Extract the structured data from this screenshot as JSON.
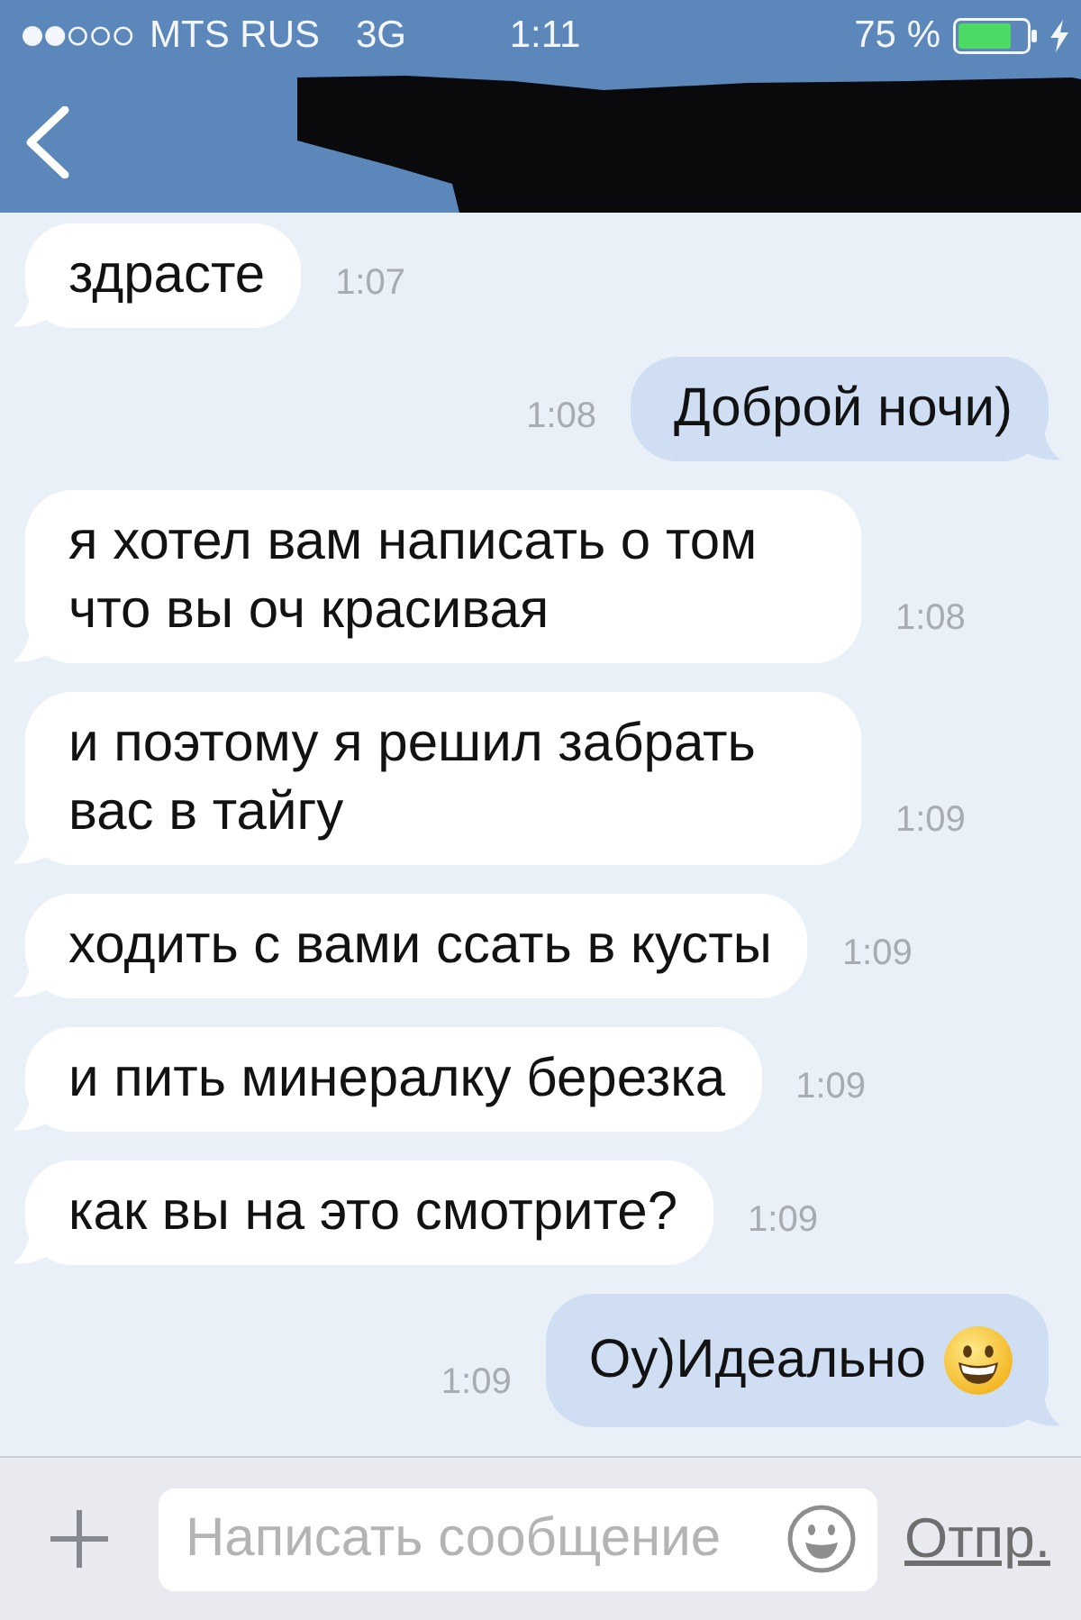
{
  "status_bar": {
    "carrier": "MTS RUS",
    "network": "3G",
    "time": "1:11",
    "battery": "75 %",
    "charging": true
  },
  "nav_bar": {
    "redacted": true
  },
  "messages": [
    {
      "outgoing": false,
      "kind": "text",
      "text": "здрасте",
      "time": "1:07"
    },
    {
      "outgoing": true,
      "kind": "text",
      "text": "Доброй ночи)",
      "time": "1:08"
    },
    {
      "outgoing": false,
      "kind": "text",
      "text": "я хотел вам написать о том что вы оч красивая",
      "time": "1:08"
    },
    {
      "outgoing": false,
      "kind": "text",
      "text": "и поэтому я решил забрать вас в тайгу",
      "time": "1:09"
    },
    {
      "outgoing": false,
      "kind": "text",
      "text": "ходить с вами ссать в кусты",
      "time": "1:09"
    },
    {
      "outgoing": false,
      "kind": "text",
      "text": "и пить минералку березка",
      "time": "1:09"
    },
    {
      "outgoing": false,
      "kind": "text",
      "text": "как вы на это смотрите?",
      "time": "1:09"
    },
    {
      "outgoing": true,
      "kind": "text_emoji",
      "text": "Оу)Идеально",
      "time": "1:09"
    }
  ],
  "composer": {
    "placeholder": "Написать сообщение",
    "send_label": "Отпр."
  }
}
